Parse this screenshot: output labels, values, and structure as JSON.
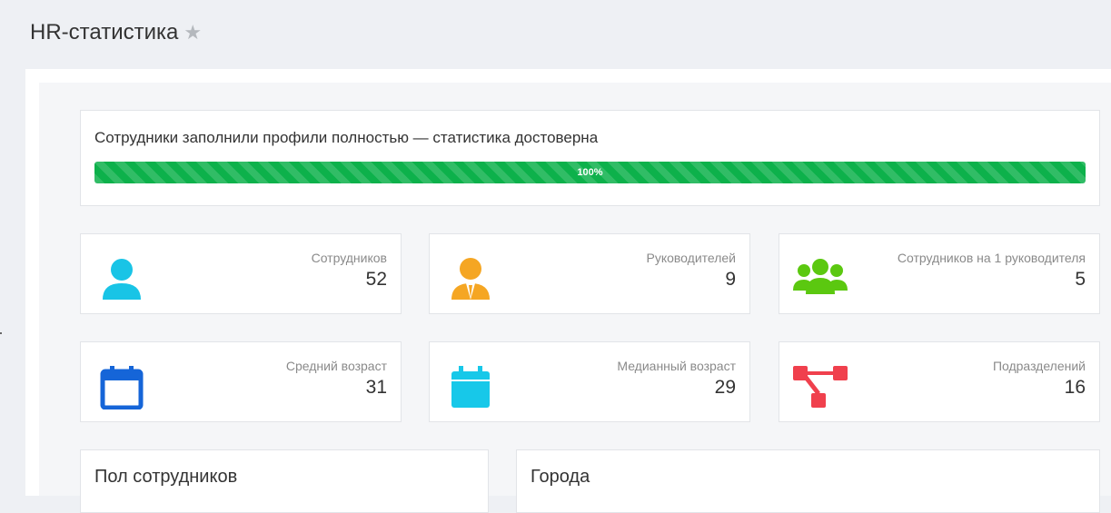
{
  "header": {
    "title": "HR-статистика"
  },
  "progress": {
    "title": "Сотрудники заполнили профили полностью — статистика достоверна",
    "label": "100%",
    "value": 1.0,
    "color": "#0db14b"
  },
  "stats": [
    {
      "label": "Сотрудников",
      "value": "52",
      "icon": "user-icon",
      "color": "#19c4e6"
    },
    {
      "label": "Руководителей",
      "value": "9",
      "icon": "manager-icon",
      "color": "#f5a623"
    },
    {
      "label": "Сотрудников на 1 руководителя",
      "value": "5",
      "icon": "group-icon",
      "color": "#5bc810"
    },
    {
      "label": "Средний возраст",
      "value": "31",
      "icon": "calendar-outline-icon",
      "color": "#1565d8"
    },
    {
      "label": "Медианный возраст",
      "value": "29",
      "icon": "calendar-filled-icon",
      "color": "#17c8e9"
    },
    {
      "label": "Подразделений",
      "value": "16",
      "icon": "org-structure-icon",
      "color": "#f0404d"
    }
  ],
  "sections": [
    {
      "title": "Пол сотрудников"
    },
    {
      "title": "Города"
    }
  ]
}
